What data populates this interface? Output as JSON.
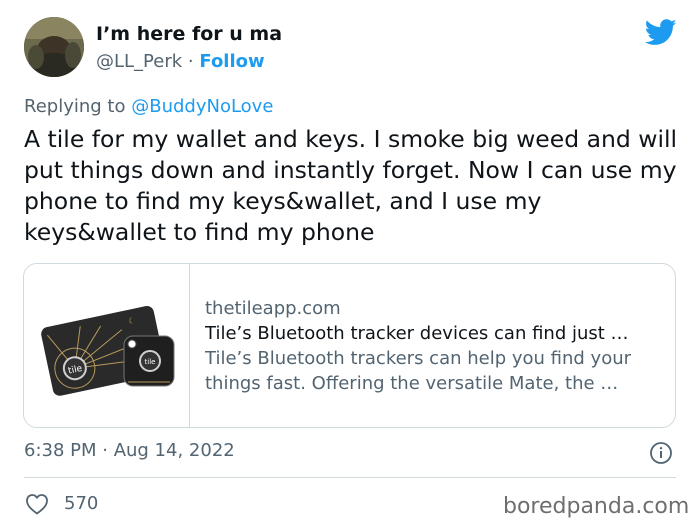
{
  "tweet": {
    "display_name": "I’m here for u ma",
    "handle": "@LL_Perk",
    "separator": "·",
    "follow_label": "Follow",
    "reply_prefix": "Replying to",
    "reply_to": "@BuddyNoLove",
    "text": "A tile for my wallet and keys. I smoke big weed and will put things down and instantly forget. Now I can use my phone to find my keys&wallet, and I use my keys&wallet to find my phone",
    "timestamp": "6:38 PM · Aug 14, 2022",
    "likes": "570"
  },
  "card": {
    "domain": "thetileapp.com",
    "title": "Tile’s Bluetooth tracker devices can find just …",
    "description": "Tile’s Bluetooth trackers can help you find your things fast. Offering the versatile Mate, the …",
    "image_label": "tile"
  },
  "watermark": "boredpanda.com",
  "colors": {
    "accent": "#1d9bf0",
    "text": "#0f1419",
    "secondary": "#536471",
    "border": "#cfd9de"
  },
  "icons": {
    "logo": "twitter-bird-icon",
    "info": "info-icon",
    "like": "heart-icon"
  }
}
